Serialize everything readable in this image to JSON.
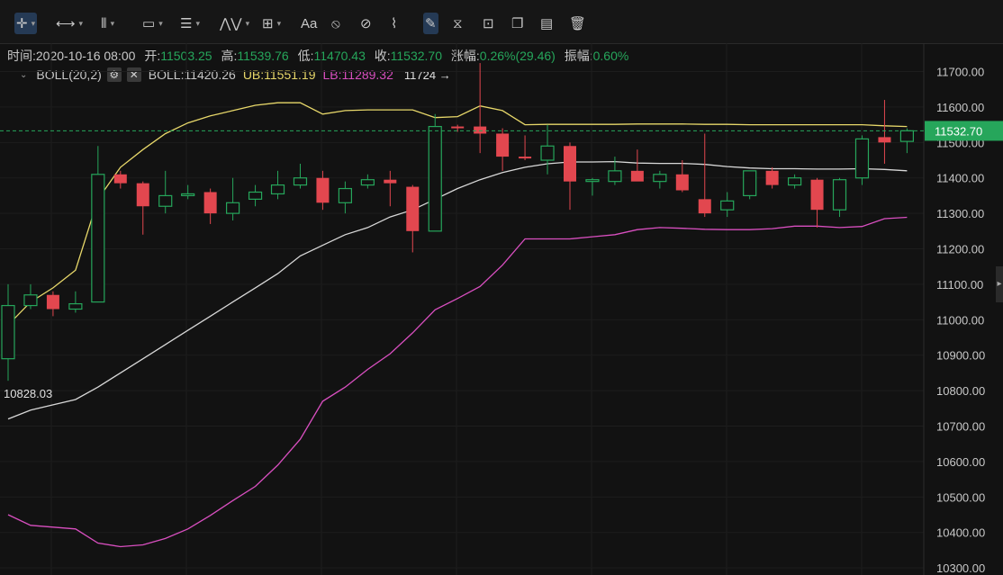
{
  "toolbar": {
    "tools": [
      {
        "name": "crosshair-icon",
        "glyph": "✛",
        "caret": true,
        "x": 16,
        "active": true
      },
      {
        "name": "measure-horizontal-icon",
        "glyph": "⟷",
        "caret": true,
        "x": 62
      },
      {
        "name": "vertical-lines-icon",
        "glyph": "⦀",
        "caret": true,
        "x": 112
      },
      {
        "name": "rectangle-icon",
        "glyph": "▭",
        "caret": true,
        "x": 158
      },
      {
        "name": "fibonacci-icon",
        "glyph": "☰",
        "caret": true,
        "x": 200
      },
      {
        "name": "wave-pattern-icon",
        "glyph": "⋀⋁",
        "caret": true,
        "x": 244
      },
      {
        "name": "crosshair-plus-icon",
        "glyph": "⊞",
        "caret": true,
        "x": 291
      },
      {
        "name": "text-tool-icon",
        "glyph": "Aa",
        "caret": false,
        "x": 334
      },
      {
        "name": "hide-drawings-icon",
        "glyph": "⦸",
        "caret": false,
        "x": 368
      },
      {
        "name": "magnet-icon",
        "glyph": "⊘",
        "caret": false,
        "x": 400
      },
      {
        "name": "ruler-icon",
        "glyph": "⌇",
        "caret": false,
        "x": 434
      },
      {
        "name": "draw-mode-icon",
        "glyph": "✎",
        "caret": false,
        "x": 470,
        "active": true
      },
      {
        "name": "indicator-icon",
        "glyph": "⧖",
        "caret": false,
        "x": 503
      },
      {
        "name": "lock-icon",
        "glyph": "⊡",
        "caret": false,
        "x": 536
      },
      {
        "name": "copy-icon",
        "glyph": "❐",
        "caret": false,
        "x": 568
      },
      {
        "name": "settings-list-icon",
        "glyph": "▤",
        "caret": false,
        "x": 600
      },
      {
        "name": "delete-icon",
        "glyph": "🗑",
        "caret": false,
        "x": 632
      }
    ]
  },
  "info": {
    "time_label": "时间:",
    "time_value": "2020-10-16 08:00",
    "open_label": "开:",
    "open_value": "11503.25",
    "high_label": "高:",
    "high_value": "11539.76",
    "low_label": "低:",
    "low_value": "11470.43",
    "close_label": "收:",
    "close_value": "11532.70",
    "change_label": "涨幅:",
    "change_value": "0.26%(29.46)",
    "amp_label": "振幅:",
    "amp_value": "0.60%"
  },
  "boll": {
    "name": "BOLL(20,2)",
    "mid": "BOLL:11420.26",
    "ub": "UB:11551.19",
    "lb": "LB:11289.32",
    "max_label": "11724 →",
    "min_label": "10828.03"
  },
  "colors": {
    "up": "#26a65b",
    "down": "#e2474f",
    "ub": "#e8d86a",
    "mid": "#d8d8d8",
    "lb": "#d94fc0",
    "bg": "#121212",
    "grid": "#1e1e1e"
  },
  "chart_data": {
    "type": "candlestick",
    "ylim": [
      10280,
      11780
    ],
    "y_ticks": [
      11700,
      11600,
      11500,
      11400,
      11300,
      11200,
      11100,
      11000,
      10900,
      10800,
      10700,
      10600,
      10500,
      10400,
      10300
    ],
    "y_tick_labels": [
      "11700.00",
      "11600.00",
      "11500.00",
      "11400.00",
      "11300.00",
      "11200.00",
      "11100.00",
      "11000.00",
      "10900.00",
      "10800.00",
      "10700.00",
      "10600.00",
      "10500.00",
      "10400.00",
      "10300.00"
    ],
    "last_price": 11532.7,
    "last_price_label": "11532.70",
    "candles": [
      {
        "o": 10890,
        "h": 11100,
        "l": 10828,
        "c": 11040
      },
      {
        "o": 11040,
        "h": 11100,
        "l": 11030,
        "c": 11070
      },
      {
        "o": 11070,
        "h": 11080,
        "l": 11010,
        "c": 11030
      },
      {
        "o": 11030,
        "h": 11080,
        "l": 11020,
        "c": 11045
      },
      {
        "o": 11050,
        "h": 11490,
        "l": 11050,
        "c": 11410
      },
      {
        "o": 11410,
        "h": 11420,
        "l": 11370,
        "c": 11385
      },
      {
        "o": 11385,
        "h": 11390,
        "l": 11240,
        "c": 11320
      },
      {
        "o": 11320,
        "h": 11420,
        "l": 11300,
        "c": 11350
      },
      {
        "o": 11350,
        "h": 11380,
        "l": 11340,
        "c": 11355
      },
      {
        "o": 11360,
        "h": 11370,
        "l": 11270,
        "c": 11300
      },
      {
        "o": 11300,
        "h": 11400,
        "l": 11280,
        "c": 11330
      },
      {
        "o": 11340,
        "h": 11380,
        "l": 11320,
        "c": 11360
      },
      {
        "o": 11355,
        "h": 11420,
        "l": 11340,
        "c": 11380
      },
      {
        "o": 11380,
        "h": 11440,
        "l": 11370,
        "c": 11400
      },
      {
        "o": 11400,
        "h": 11420,
        "l": 11310,
        "c": 11330
      },
      {
        "o": 11330,
        "h": 11390,
        "l": 11300,
        "c": 11370
      },
      {
        "o": 11380,
        "h": 11410,
        "l": 11370,
        "c": 11395
      },
      {
        "o": 11395,
        "h": 11420,
        "l": 11320,
        "c": 11385
      },
      {
        "o": 11375,
        "h": 11380,
        "l": 11190,
        "c": 11250
      },
      {
        "o": 11250,
        "h": 11580,
        "l": 11250,
        "c": 11545
      },
      {
        "o": 11545,
        "h": 11550,
        "l": 11530,
        "c": 11540
      },
      {
        "o": 11545,
        "h": 11724,
        "l": 11470,
        "c": 11525
      },
      {
        "o": 11525,
        "h": 11540,
        "l": 11420,
        "c": 11460
      },
      {
        "o": 11460,
        "h": 11520,
        "l": 11450,
        "c": 11455
      },
      {
        "o": 11450,
        "h": 11550,
        "l": 11410,
        "c": 11490
      },
      {
        "o": 11490,
        "h": 11500,
        "l": 11310,
        "c": 11390
      },
      {
        "o": 11390,
        "h": 11400,
        "l": 11350,
        "c": 11395
      },
      {
        "o": 11390,
        "h": 11460,
        "l": 11380,
        "c": 11420
      },
      {
        "o": 11420,
        "h": 11480,
        "l": 11400,
        "c": 11390
      },
      {
        "o": 11390,
        "h": 11420,
        "l": 11370,
        "c": 11410
      },
      {
        "o": 11410,
        "h": 11450,
        "l": 11360,
        "c": 11365
      },
      {
        "o": 11340,
        "h": 11525,
        "l": 11290,
        "c": 11300
      },
      {
        "o": 11310,
        "h": 11360,
        "l": 11290,
        "c": 11335
      },
      {
        "o": 11350,
        "h": 11420,
        "l": 11340,
        "c": 11420
      },
      {
        "o": 11420,
        "h": 11430,
        "l": 11370,
        "c": 11380
      },
      {
        "o": 11380,
        "h": 11410,
        "l": 11370,
        "c": 11400
      },
      {
        "o": 11395,
        "h": 11400,
        "l": 11260,
        "c": 11310
      },
      {
        "o": 11310,
        "h": 11400,
        "l": 11290,
        "c": 11395
      },
      {
        "o": 11400,
        "h": 11520,
        "l": 11380,
        "c": 11510
      },
      {
        "o": 11515,
        "h": 11620,
        "l": 11440,
        "c": 11500
      },
      {
        "o": 11503,
        "h": 11540,
        "l": 11470,
        "c": 11533
      }
    ],
    "series": [
      {
        "name": "UB",
        "values": [
          10985,
          11050,
          11090,
          11140,
          11340,
          11430,
          11480,
          11525,
          11555,
          11575,
          11590,
          11605,
          11612,
          11612,
          11580,
          11590,
          11592,
          11592,
          11592,
          11570,
          11573,
          11603,
          11590,
          11550,
          11551,
          11551,
          11551,
          11551,
          11552,
          11552,
          11552,
          11551,
          11551,
          11550,
          11550,
          11550,
          11550,
          11550,
          11550,
          11547,
          11545
        ]
      },
      {
        "name": "BOLL",
        "values": [
          10720,
          10745,
          10760,
          10775,
          10810,
          10850,
          10890,
          10930,
          10970,
          11010,
          11050,
          11090,
          11130,
          11180,
          11210,
          11240,
          11260,
          11290,
          11310,
          11340,
          11370,
          11395,
          11415,
          11430,
          11440,
          11445,
          11445,
          11446,
          11442,
          11441,
          11441,
          11438,
          11432,
          11428,
          11426,
          11426,
          11425,
          11425,
          11426,
          11424,
          11420
        ]
      },
      {
        "name": "LB",
        "values": [
          10450,
          10420,
          10415,
          10410,
          10370,
          10360,
          10365,
          10383,
          10410,
          10448,
          10490,
          10530,
          10590,
          10663,
          10770,
          10810,
          10860,
          10904,
          10963,
          11028,
          11060,
          11094,
          11154,
          11228,
          11228,
          11228,
          11234,
          11240,
          11254,
          11260,
          11258,
          11255,
          11254,
          11254,
          11257,
          11264,
          11264,
          11260,
          11263,
          11285,
          11289
        ]
      }
    ]
  }
}
